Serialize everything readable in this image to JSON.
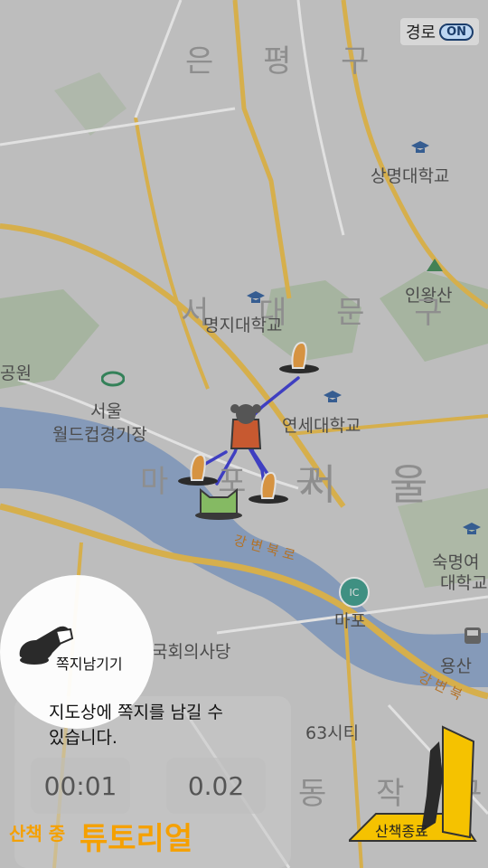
{
  "route_toggle": {
    "label": "경로",
    "state": "ON"
  },
  "map_labels": {
    "eunpyeong": "은 평 구",
    "sangmyung": "상명대학교",
    "inwangsan": "인왕산",
    "seodaemun": "서 대 문 구",
    "myongji": "명지대학교",
    "park": "공원",
    "worldcup_1": "서울",
    "worldcup_2": "월드컵경기장",
    "yonsei": "연세대학교",
    "mapo": "마 포 구",
    "seoul": "서 울",
    "sookmyung_1": "숙명여",
    "sookmyung_2": "대학교",
    "gangbyeonbukro_1": "강 변 북 로",
    "ic": "IC",
    "mapo_ic": "마포",
    "assembly": "국회의사당",
    "yongsan": "용산",
    "gangbyeonbukro_2": "강 변 북",
    "building63": "63시티",
    "dongjak": "동 작 구",
    "yeongdeungpo": "구"
  },
  "tutorial": {
    "note_button": "쪽지남기기",
    "description_line1": "지도상에 쪽지를 남길 수",
    "description_line2": "있습니다."
  },
  "stats": {
    "time": "00:01",
    "distance": "0.02"
  },
  "status": {
    "walking": "산책 중",
    "tutorial": "튜토리얼"
  },
  "end_button": "산책종료",
  "colors": {
    "accent": "#f5a000",
    "route": "#3a3ad8",
    "road": "#f2c24a",
    "water": "#8fa9cf"
  }
}
